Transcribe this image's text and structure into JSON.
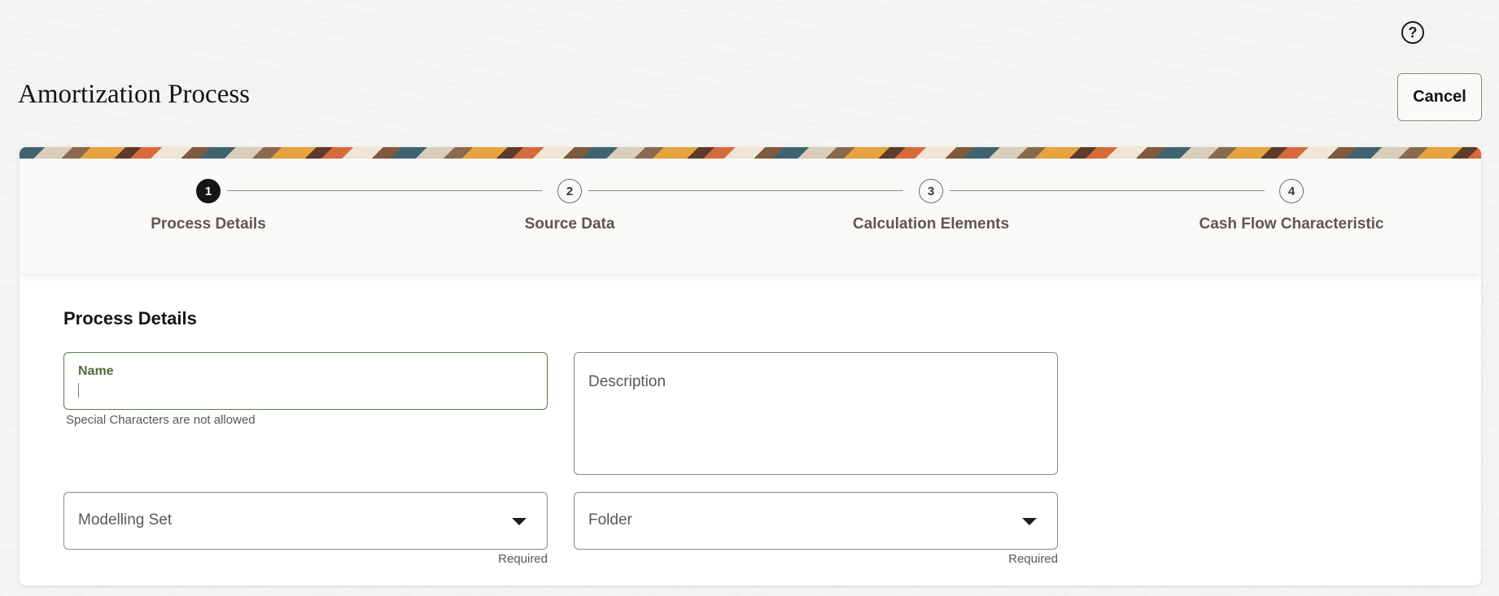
{
  "header": {
    "title": "Amortization Process",
    "help_icon": "help-circle-icon",
    "help_glyph": "?",
    "cancel_label": "Cancel"
  },
  "stepper": {
    "steps": [
      {
        "number": "1",
        "label": "Process Details",
        "state": "active"
      },
      {
        "number": "2",
        "label": "Source Data",
        "state": "inactive"
      },
      {
        "number": "3",
        "label": "Calculation Elements",
        "state": "inactive"
      },
      {
        "number": "4",
        "label": "Cash Flow Characteristic",
        "state": "inactive"
      }
    ]
  },
  "form": {
    "section_title": "Process Details",
    "name": {
      "label": "Name",
      "value": "",
      "helper": "Special Characters are not allowed"
    },
    "description": {
      "placeholder": "Description",
      "value": ""
    },
    "modelling_set": {
      "placeholder": "Modelling Set",
      "helper": "Required",
      "icon": "chevron-down-icon"
    },
    "folder": {
      "placeholder": "Folder",
      "helper": "Required",
      "icon": "chevron-down-icon"
    }
  },
  "colors": {
    "accent_green": "#4c6b3a",
    "active_step": "#161513",
    "banner": [
      "#3f6470",
      "#e6a340",
      "#d76a3a",
      "#5e3b2a"
    ]
  }
}
